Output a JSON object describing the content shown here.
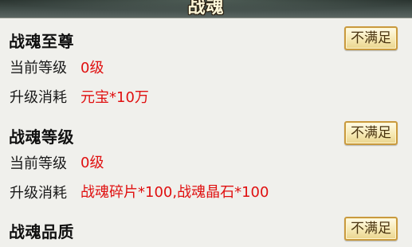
{
  "window": {
    "title": "战魂"
  },
  "sections": [
    {
      "title": "战魂至尊",
      "status_button": "不满足",
      "rows": [
        {
          "label": "当前等级",
          "value": "0级"
        },
        {
          "label": "升级消耗",
          "value": "元宝*10万"
        }
      ]
    },
    {
      "title": "战魂等级",
      "status_button": "不满足",
      "rows": [
        {
          "label": "当前等级",
          "value": "0级"
        },
        {
          "label": "升级消耗",
          "value": "战魂碎片*100,战魂晶石*100"
        }
      ]
    },
    {
      "title": "战魂品质",
      "status_button": "不满足",
      "rows": []
    }
  ],
  "colors": {
    "value_text": "#e01010",
    "button_border": "#c99a3e",
    "panel_bg": "#f0f0ec"
  }
}
